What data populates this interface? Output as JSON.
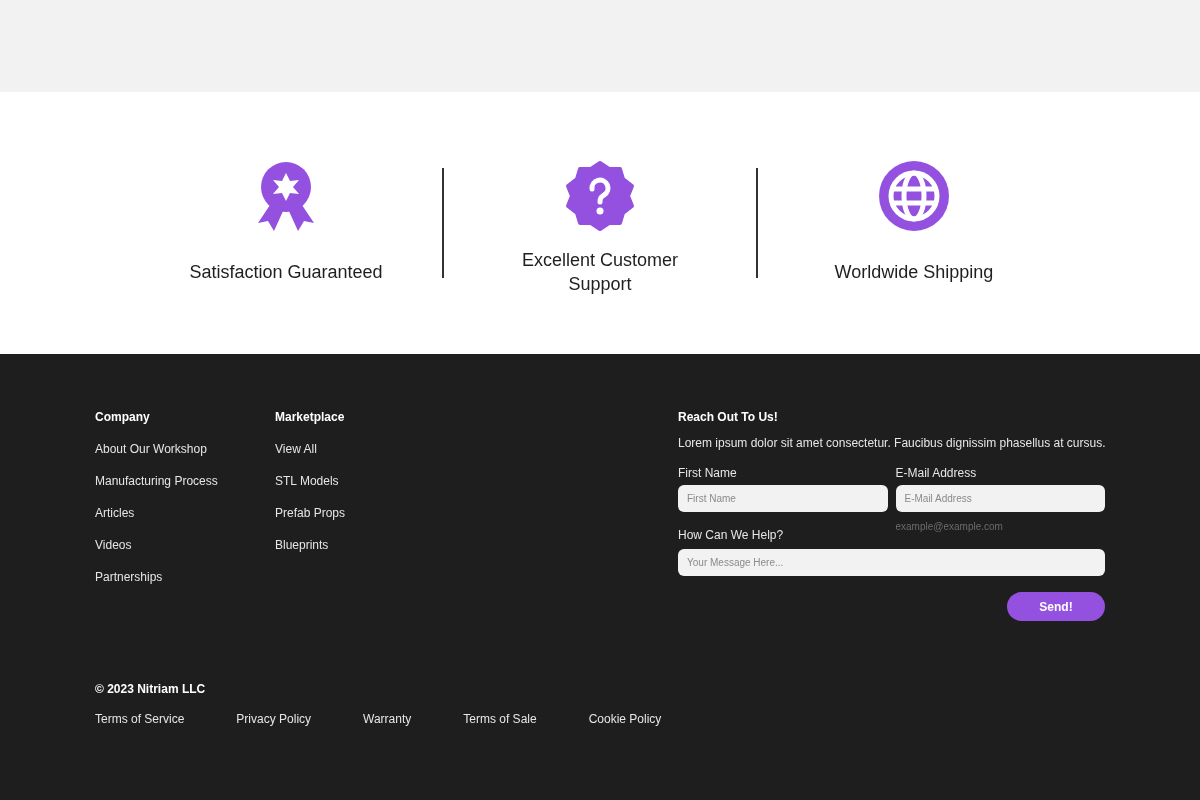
{
  "features": [
    {
      "kind": "award",
      "title": "Satisfaction Guaranteed"
    },
    {
      "kind": "help",
      "title": "Excellent Customer Support"
    },
    {
      "kind": "globe",
      "title": "Worldwide Shipping"
    }
  ],
  "footer": {
    "columns": [
      {
        "heading": "Company",
        "links": [
          "About Our Workshop",
          "Manufacturing Process",
          "Articles",
          "Videos",
          "Partnerships"
        ]
      },
      {
        "heading": "Marketplace",
        "links": [
          "View All",
          "STL Models",
          "Prefab Props",
          "Blueprints"
        ]
      }
    ],
    "contact": {
      "heading": "Reach Out To Us!",
      "text": "Lorem ipsum dolor sit amet consectetur. Faucibus dignissim phasellus at cursus.",
      "first_name": {
        "label": "First Name",
        "placeholder": "First Name"
      },
      "email": {
        "label": "E-Mail Address",
        "placeholder": "E-Mail Address",
        "hint": "example@example.com"
      },
      "message": {
        "label": "How Can We Help?",
        "placeholder": "Your Message Here..."
      },
      "button": "Send!"
    },
    "copyright": "© 2023 Nitriam LLC",
    "legal_links": [
      "Terms of Service",
      "Privacy Policy",
      "Warranty",
      "Terms of Sale",
      "Cookie Policy"
    ]
  }
}
